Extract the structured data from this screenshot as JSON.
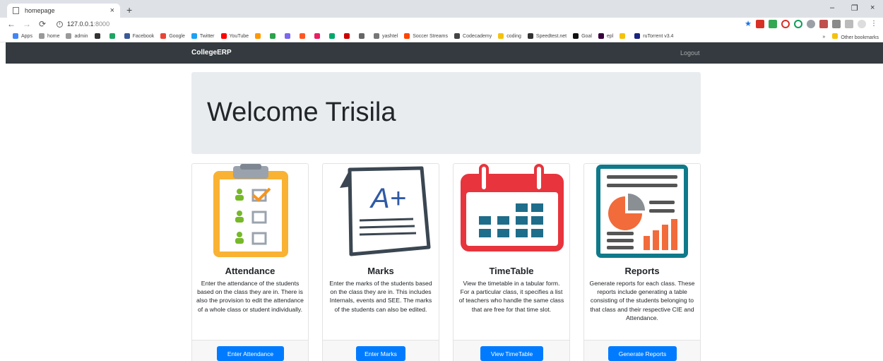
{
  "browser": {
    "tab_title": "homepage",
    "tab_close": "×",
    "new_tab": "+",
    "url_host": "127.0.0.1",
    "url_port": ":8000",
    "window_controls": [
      "–",
      "❐",
      "×"
    ],
    "bookmarks": [
      {
        "label": "Apps",
        "icon": "apps-icon",
        "color": "#4285f4"
      },
      {
        "label": "home",
        "icon": "page-icon",
        "color": "#999999"
      },
      {
        "label": "admin",
        "icon": "page-icon",
        "color": "#999999"
      },
      {
        "label": "",
        "icon": "square-icon",
        "color": "#333333"
      },
      {
        "label": "",
        "icon": "drive-icon",
        "color": "#1fa463"
      },
      {
        "label": "Facebook",
        "icon": "facebook-icon",
        "color": "#3b5998"
      },
      {
        "label": "Google",
        "icon": "google-icon",
        "color": "#ea4335"
      },
      {
        "label": "Twitter",
        "icon": "twitter-icon",
        "color": "#1da1f2"
      },
      {
        "label": "YouTube",
        "icon": "youtube-icon",
        "color": "#ff0000"
      },
      {
        "label": "",
        "icon": "amazon-icon",
        "color": "#ff9900"
      },
      {
        "label": "",
        "icon": "circle-icon",
        "color": "#2ba24c"
      },
      {
        "label": "",
        "icon": "chat-icon",
        "color": "#7b68ee"
      },
      {
        "label": "",
        "icon": "ghost-icon",
        "color": "#ff5722"
      },
      {
        "label": "",
        "icon": "link-icon",
        "color": "#e91e63"
      },
      {
        "label": "",
        "icon": "box-icon",
        "color": "#00a86b"
      },
      {
        "label": "",
        "icon": "flag-icon",
        "color": "#cc0000"
      },
      {
        "label": "",
        "icon": "ring-icon",
        "color": "#666666"
      },
      {
        "label": "yashtel",
        "icon": "moon-icon",
        "color": "#777777"
      },
      {
        "label": "Soccer Streams",
        "icon": "reddit-icon",
        "color": "#ff4500"
      },
      {
        "label": "Codecademy",
        "icon": "codecademy-icon",
        "color": "#444444"
      },
      {
        "label": "coding",
        "icon": "folder-icon",
        "color": "#f4c20d"
      },
      {
        "label": "Speedtest.net",
        "icon": "speedtest-icon",
        "color": "#333333"
      },
      {
        "label": "Goal",
        "icon": "goal-icon",
        "color": "#111111"
      },
      {
        "label": "epl",
        "icon": "epl-icon",
        "color": "#38003c"
      },
      {
        "label": "",
        "icon": "folder-icon",
        "color": "#f4c20d"
      },
      {
        "label": "ruTorrent v3.4",
        "icon": "torrent-icon",
        "color": "#1a237e"
      }
    ],
    "more_bookmarks": "»",
    "other_bookmarks": "Other bookmarks"
  },
  "navbar": {
    "brand": "CollegeERP",
    "logout": "Logout"
  },
  "jumbotron": {
    "heading": "Welcome Trisila"
  },
  "cards": [
    {
      "title": "Attendance",
      "text": "Enter the attendance of the students based on the class they are in. There is also the provision to edit the attendance of a whole class or student individually.",
      "button": "Enter Attendance"
    },
    {
      "title": "Marks",
      "text": "Enter the marks of the students based on the class they are in. This includes Internals, events and SEE. The marks of the students can also be edited.",
      "button": "Enter Marks",
      "grade": "A+"
    },
    {
      "title": "TimeTable",
      "text": "View the timetable in a tabular form. For a particular class, it specifies a list of teachers who handle the same class that are free for that time slot.",
      "button": "View TimeTable"
    },
    {
      "title": "Reports",
      "text": "Generate reports for each class. These reports include generating a table consisting of the students belonging to that class and their respective CIE and Attendance.",
      "button": "Generate Reports"
    }
  ],
  "colors": {
    "navbar_bg": "#343a40",
    "jumbotron_bg": "#e9ecef",
    "button_primary": "#007bff",
    "clipboard_yellow": "#f9b233",
    "calendar_red": "#e8343c",
    "report_teal": "#0f7a8a",
    "report_orange": "#f26b3a"
  }
}
